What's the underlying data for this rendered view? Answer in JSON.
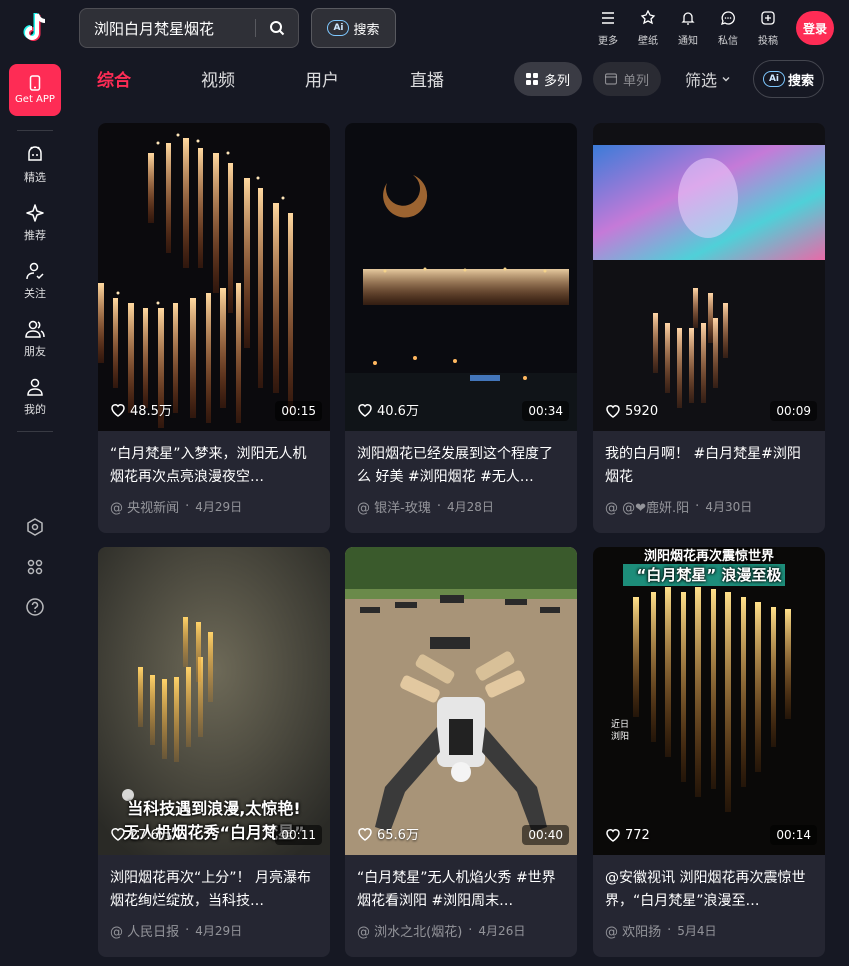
{
  "search": {
    "value": "浏阳白月梵星烟花"
  },
  "ai_search_label": "搜索",
  "ai_badge": "Ai",
  "top_icons": [
    {
      "label": "更多",
      "icon": "menu-icon"
    },
    {
      "label": "壁纸",
      "icon": "wallpaper-icon"
    },
    {
      "label": "通知",
      "icon": "bell-icon"
    },
    {
      "label": "私信",
      "icon": "message-icon"
    },
    {
      "label": "投稿",
      "icon": "upload-icon"
    }
  ],
  "login_label": "登录",
  "sidebar": {
    "get_app": "Get APP",
    "items": [
      {
        "label": "精选",
        "icon": "featured-icon"
      },
      {
        "label": "推荐",
        "icon": "sparkle-icon"
      },
      {
        "label": "关注",
        "icon": "follow-icon"
      },
      {
        "label": "朋友",
        "icon": "friends-icon"
      },
      {
        "label": "我的",
        "icon": "profile-icon"
      }
    ]
  },
  "tabs": [
    {
      "label": "综合",
      "active": true
    },
    {
      "label": "视频",
      "active": false
    },
    {
      "label": "用户",
      "active": false
    },
    {
      "label": "直播",
      "active": false
    }
  ],
  "view_multi": "多列",
  "view_single": "单列",
  "filter_label": "筛选",
  "ai_pill_label": "搜索",
  "colors": {
    "accent": "#fe2c55",
    "background": "#161823",
    "card": "#252632"
  },
  "cards": [
    {
      "likes": "48.5万",
      "duration": "00:15",
      "title": "“白月梵星”入梦来，浏阳无人机烟花再次点亮浪漫夜空…",
      "author": "@ 央视新闻",
      "date": "4月29日"
    },
    {
      "likes": "40.6万",
      "duration": "00:34",
      "title": "浏阳烟花已经发展到这个程度了么 好美 #浏阳烟花 #无人…",
      "author": "@ 银洋-玫瑰",
      "date": "4月28日"
    },
    {
      "likes": "5920",
      "duration": "00:09",
      "title": "我的白月啊！ #白月梵星#浏阳烟花",
      "author": "@ @❤鹿妍.阳",
      "date": "4月30日"
    },
    {
      "likes": "27.6万",
      "duration": "00:11",
      "title": "浏阳烟花再次“上分”！ 月亮瀑布烟花绚烂绽放，当科技…",
      "author": "@ 人民日报",
      "date": "4月29日",
      "overlay": [
        "当科技遇到浪漫,太惊艳!",
        "无人机烟花秀“白月梵星”"
      ]
    },
    {
      "likes": "65.6万",
      "duration": "00:40",
      "title": "“白月梵星”无人机焰火秀 #世界烟花看浏阳 #浏阳周末…",
      "author": "@ 浏水之北(烟花)",
      "date": "4月26日"
    },
    {
      "likes": "772",
      "duration": "00:14",
      "title": "@安徽视讯 浏阳烟花再次震惊世界，“白月梵星”浪漫至…",
      "author": "@ 欢阳扬",
      "date": "5月4日",
      "overlay": [
        "浏阳烟花再次震惊世界",
        "“白月梵星” 浪漫至极",
        "近日",
        "浏阳"
      ]
    }
  ]
}
